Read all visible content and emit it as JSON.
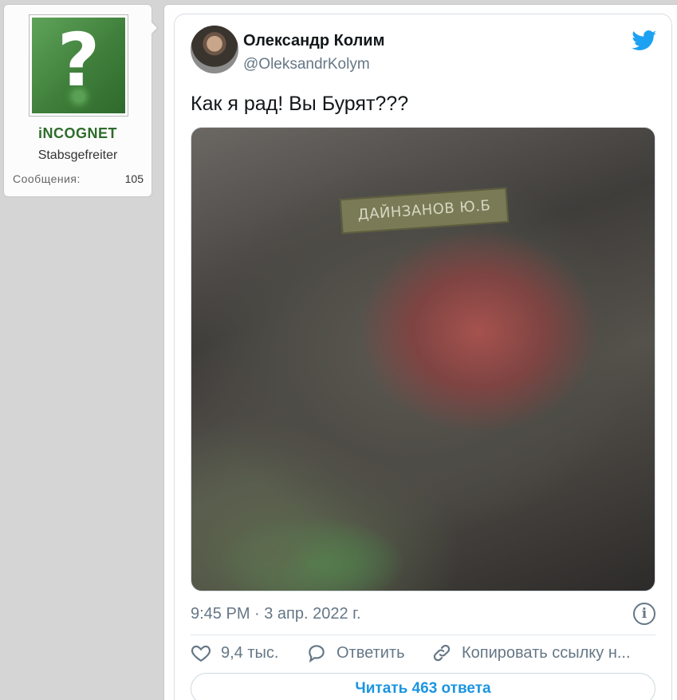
{
  "user_card": {
    "username": "iNCOGNET",
    "user_title": "Stabsgefreiter",
    "messages_label": "Сообщения:",
    "messages_count": "105",
    "avatar_icon": "question-mark-icon"
  },
  "tweet": {
    "author_name": "Олександр Колим",
    "author_handle": "@OleksandrKolym",
    "text": "Как я рад! Вы Бурят???",
    "photo_tape_text": "ДАЙНЗАНОВ Ю.Б",
    "timestamp": "9:45 PM · 3 апр. 2022 г.",
    "likes": "9,4 тыс.",
    "reply_label": "Ответить",
    "copy_link_label": "Копировать ссылку н...",
    "read_replies_label": "Читать 463 ответа",
    "brand_color": "#1da1f2"
  }
}
